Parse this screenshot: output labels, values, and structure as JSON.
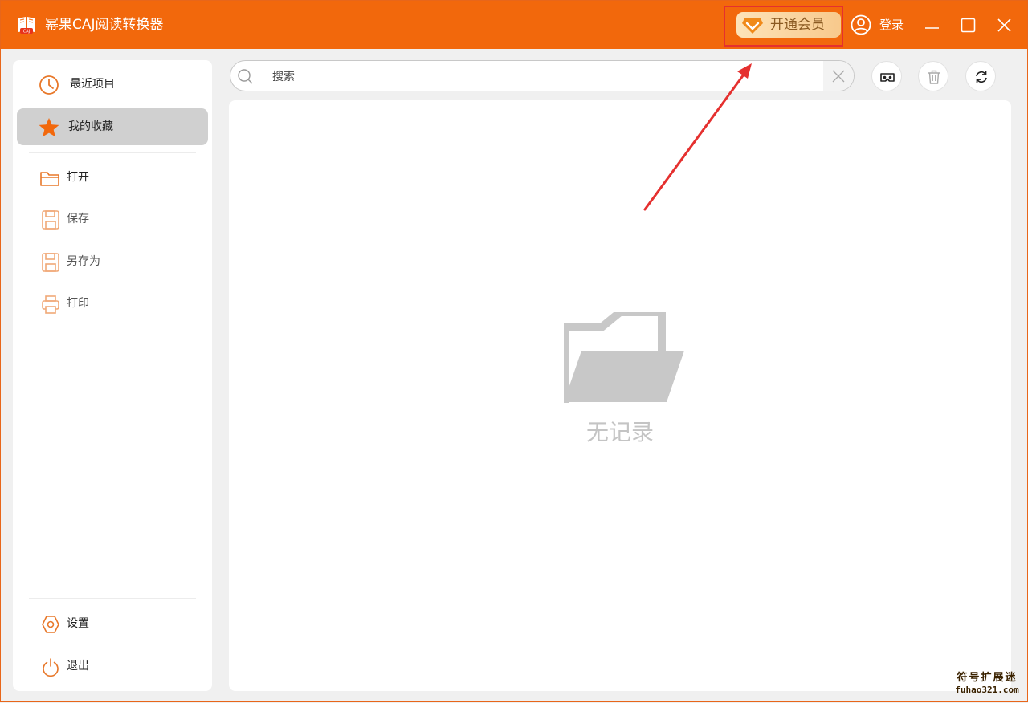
{
  "app": {
    "title": "幂果CAJ阅读转换器",
    "accent": "#f2680c"
  },
  "titlebar": {
    "vip_label": "开通会员",
    "login_label": "登录"
  },
  "sidebar": {
    "items": [
      {
        "label": "最近项目",
        "icon": "clock-icon"
      },
      {
        "label": "我的收藏",
        "icon": "star-icon",
        "active": true
      },
      {
        "label": "打开",
        "icon": "folder-icon"
      },
      {
        "label": "保存",
        "icon": "save-icon"
      },
      {
        "label": "另存为",
        "icon": "save-as-icon"
      },
      {
        "label": "打印",
        "icon": "printer-icon"
      },
      {
        "label": "设置",
        "icon": "gear-icon"
      },
      {
        "label": "退出",
        "icon": "power-icon"
      }
    ]
  },
  "search": {
    "placeholder": "搜索",
    "value": ""
  },
  "main": {
    "empty_text": "无记录"
  },
  "watermark": {
    "line1": "符号扩展迷",
    "line2": "fuhao321.com"
  }
}
